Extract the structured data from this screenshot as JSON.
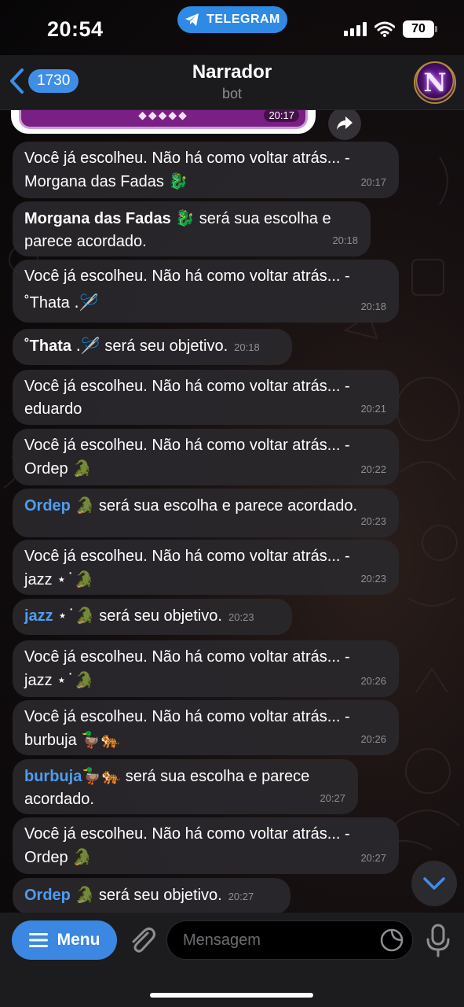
{
  "status_bar": {
    "time": "20:54",
    "app_pill": "TELEGRAM",
    "battery": "70",
    "icons": [
      "signal-icon",
      "wifi-icon",
      "battery-icon"
    ]
  },
  "header": {
    "back_count": "1730",
    "title": "Narrador",
    "subtitle": "bot",
    "avatar_letter": "N"
  },
  "media": {
    "ornament": "◆◆◆◆◆",
    "time": "20:17"
  },
  "messages": [
    {
      "line1": "Você já escolheu. Não há como voltar atrás... -",
      "line2": "Morgana das Fadas",
      "emoji": "🐉",
      "time": "20:17"
    },
    {
      "name": "Morgana das Fadas",
      "emoji": "🐉",
      "line1_rest": " será sua escolha e",
      "line2": "parece acordado.",
      "time": "20:18"
    },
    {
      "line1": "Você já escolheu. Não há como voltar atrás... -",
      "line2": "˚Thata",
      "emoji": ".🪡",
      "time": "20:18"
    },
    {
      "name": "˚Thata",
      "emoji": ".🪡",
      "rest": " será seu objetivo.",
      "time": "20:18"
    },
    {
      "line1": "Você já escolheu. Não há como voltar atrás... -",
      "line2": "eduardo",
      "time": "20:21"
    },
    {
      "line1": "Você já escolheu. Não há como voltar atrás... -",
      "line2": "Ordep",
      "emoji": "🐊",
      "time": "20:22"
    },
    {
      "name": "Ordep",
      "emoji": "🐊",
      "rest": " será sua escolha e parece acordado.",
      "time": "20:23"
    },
    {
      "line1": "Você já escolheu. Não há como voltar atrás... -",
      "line2": "jazz",
      "emoji": "⋆˙🐊",
      "time": "20:23"
    },
    {
      "name": "jazz",
      "emoji": "⋆˙🐊",
      "rest": " será seu objetivo.",
      "time": "20:23"
    },
    {
      "line1": "Você já escolheu. Não há como voltar atrás... -",
      "line2": "jazz",
      "emoji": "⋆˙🐊",
      "time": "20:26"
    },
    {
      "line1": "Você já escolheu. Não há como voltar atrás... -",
      "line2": "burbuja",
      "emoji": "🦆🐅",
      "time": "20:26"
    },
    {
      "name": "burbuja",
      "emoji": "🦆🐅",
      "line1_rest": " será sua escolha e parece",
      "line2": "acordado.",
      "time": "20:27"
    },
    {
      "line1": "Você já escolheu. Não há como voltar atrás... -",
      "line2": "Ordep",
      "emoji": "🐊",
      "time": "20:27"
    },
    {
      "name": "Ordep",
      "emoji": "🐊",
      "rest": " será seu objetivo.",
      "time": "20:27"
    }
  ],
  "input_bar": {
    "menu_label": "Menu",
    "placeholder": "Mensagem"
  },
  "colors": {
    "accent": "#3b87e2",
    "bubble": "#2a282c",
    "mention": "#4f9cf0"
  }
}
